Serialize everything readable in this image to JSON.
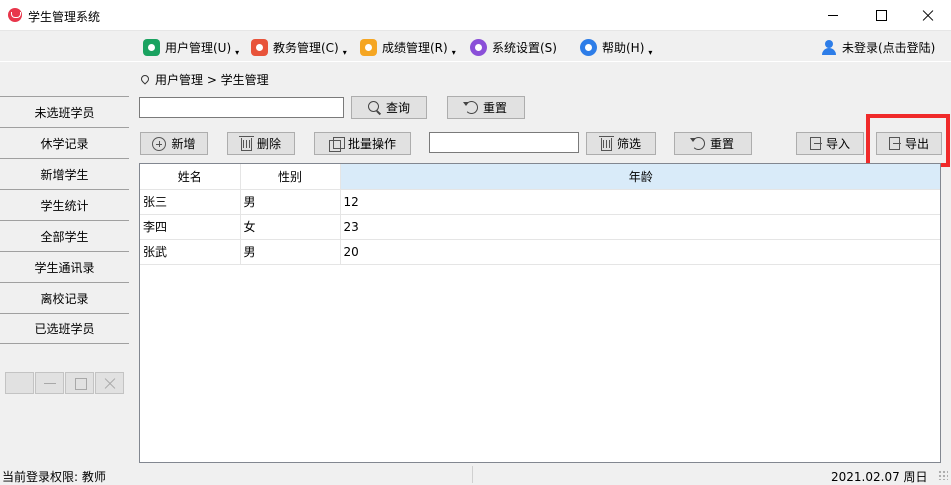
{
  "window": {
    "title": "学生管理系统"
  },
  "menu": {
    "items": [
      {
        "label": "用户管理(U)",
        "icon": "user-manage-icon",
        "color": "#1aa260"
      },
      {
        "label": "教务管理(C)",
        "icon": "teaching-icon",
        "color": "#e8533a"
      },
      {
        "label": "成绩管理(R)",
        "icon": "grades-icon",
        "color": "#f5a623"
      },
      {
        "label": "系统设置(S)",
        "icon": "settings-icon",
        "color": "#8a4fd8"
      },
      {
        "label": "帮助(H)",
        "icon": "help-icon",
        "color": "#2d7de8"
      }
    ],
    "caret": "▾",
    "login_label": "未登录(点击登陆)"
  },
  "sidebar": {
    "items": [
      "未选班学员",
      "休学记录",
      "新增学生",
      "学生统计",
      "全部学生",
      "学生通讯录",
      "离校记录",
      "已选班学员"
    ]
  },
  "breadcrumb": "用户管理 > 学生管理",
  "search": {
    "value": "",
    "query_label": "查询",
    "reset_label": "重置"
  },
  "toolbar": {
    "add_label": "新增",
    "delete_label": "删除",
    "batch_label": "批量操作",
    "filter_value": "",
    "filter_label": "筛选",
    "reset_label": "重置",
    "import_label": "导入",
    "export_label": "导出"
  },
  "table": {
    "columns": [
      "姓名",
      "性别",
      "年龄"
    ],
    "rows": [
      [
        "张三",
        "男",
        "12"
      ],
      [
        "李四",
        "女",
        "23"
      ],
      [
        "张武",
        "男",
        "20"
      ]
    ]
  },
  "status": {
    "left": "当前登录权限: 教师",
    "right": "2021.02.07 周日"
  },
  "colors": {
    "highlight": "#f02a2a",
    "selected_header": "#d9ebf9"
  }
}
